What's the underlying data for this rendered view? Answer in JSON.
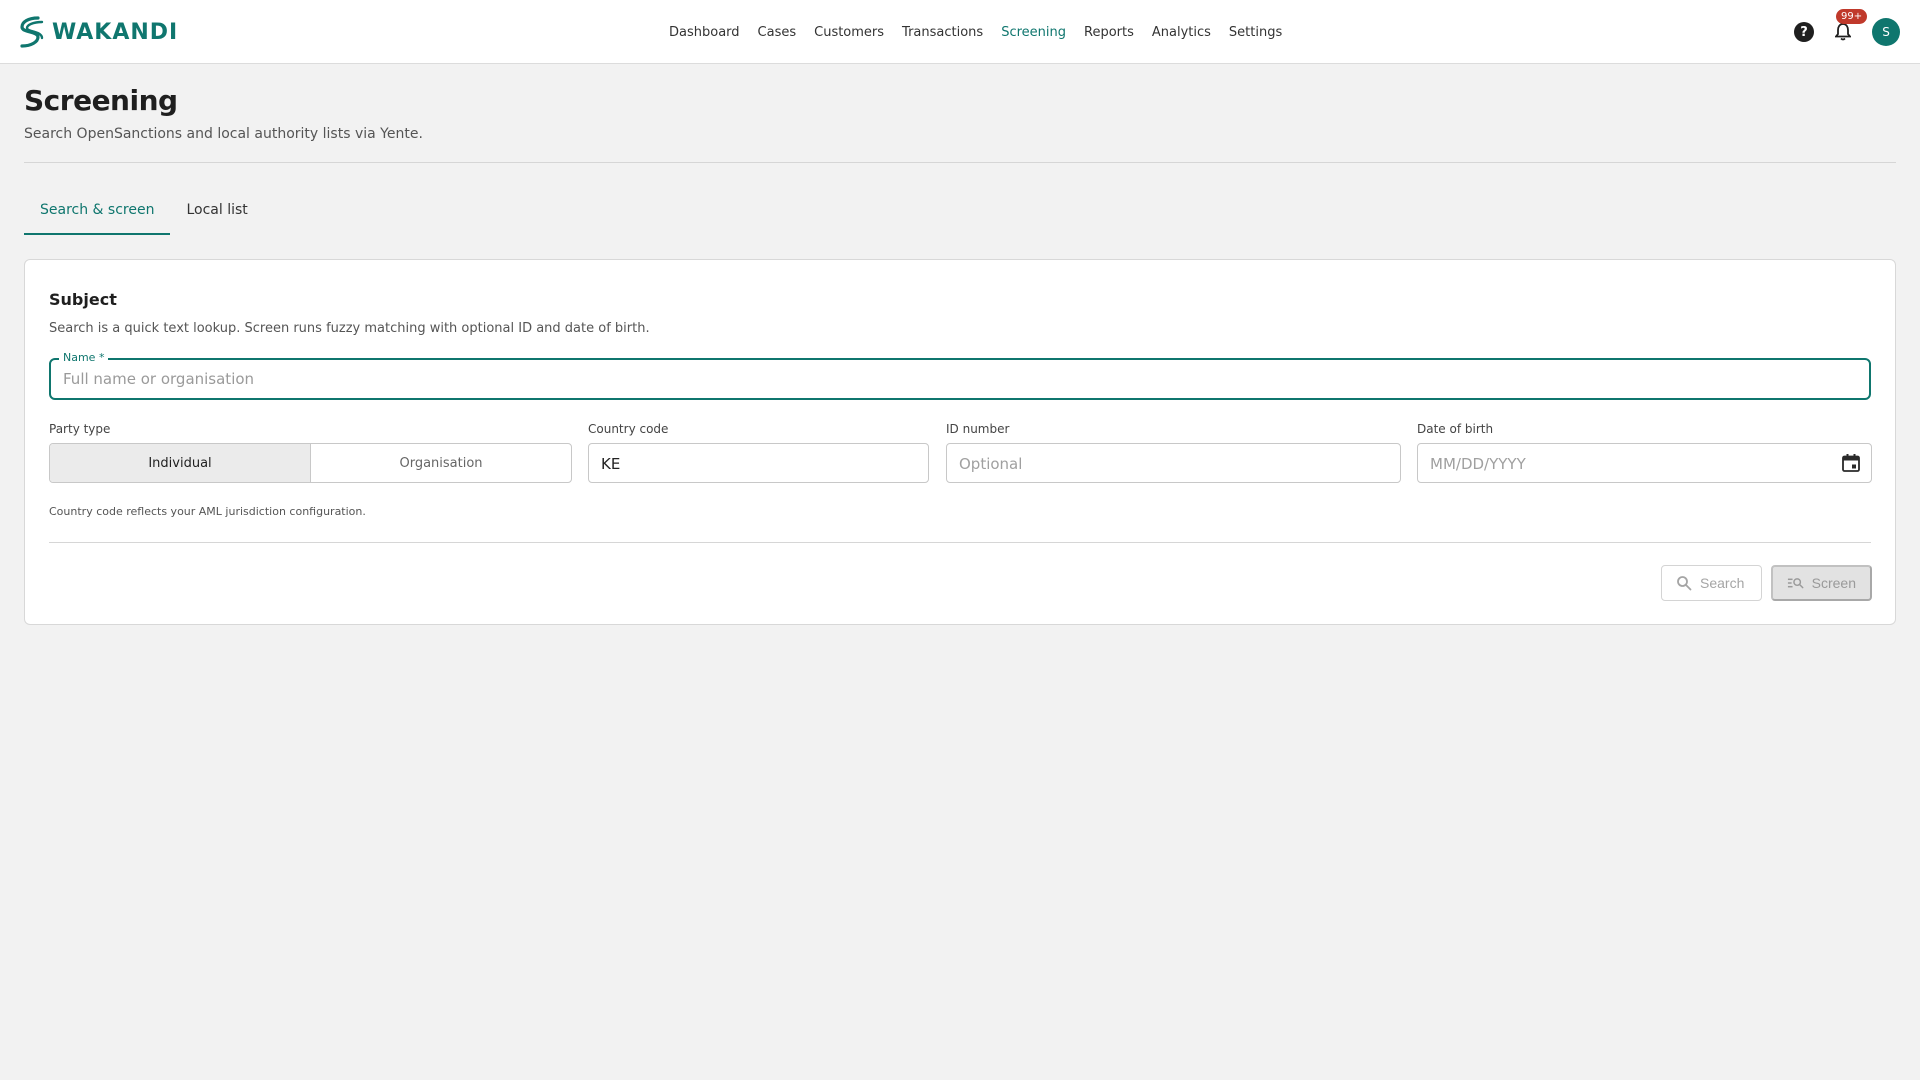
{
  "brand": {
    "name": "WAKANDI",
    "accent": "#0f766e"
  },
  "nav": {
    "items": [
      {
        "label": "Dashboard",
        "active": false
      },
      {
        "label": "Cases",
        "active": false
      },
      {
        "label": "Customers",
        "active": false
      },
      {
        "label": "Transactions",
        "active": false
      },
      {
        "label": "Screening",
        "active": true
      },
      {
        "label": "Reports",
        "active": false
      },
      {
        "label": "Analytics",
        "active": false
      },
      {
        "label": "Settings",
        "active": false
      }
    ]
  },
  "header_actions": {
    "help_icon": "help-icon",
    "notifications_badge": "99+",
    "avatar_initial": "S"
  },
  "page": {
    "title": "Screening",
    "subtitle": "Search OpenSanctions and local authority lists via Yente."
  },
  "tabs": [
    {
      "label": "Search & screen",
      "active": true
    },
    {
      "label": "Local list",
      "active": false
    }
  ],
  "subject": {
    "title": "Subject",
    "description": "Search is a quick text lookup. Screen runs fuzzy matching with optional ID and date of birth.",
    "name_label": "Name *",
    "name_placeholder": "Full name or organisation",
    "name_value": "",
    "party_type_label": "Party type",
    "party_options": [
      "Individual",
      "Organisation"
    ],
    "party_selected": "Individual",
    "country_code_label": "Country code",
    "country_code_value": "KE",
    "id_number_label": "ID number",
    "id_number_placeholder": "Optional",
    "dob_label": "Date of birth",
    "dob_placeholder": "MM/DD/YYYY",
    "hint": "Country code reflects your AML jurisdiction configuration.",
    "search_label": "Search",
    "screen_label": "Screen"
  }
}
